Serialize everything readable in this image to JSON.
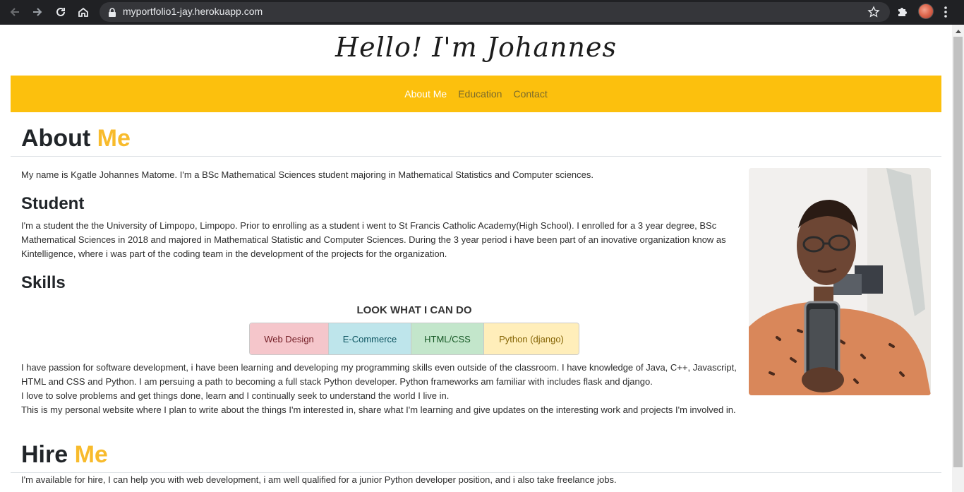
{
  "browser": {
    "url": "myportfolio1-jay.herokuapp.com"
  },
  "header": {
    "title": "Hello! I'm Johannes"
  },
  "nav": {
    "items": [
      {
        "label": "About Me"
      },
      {
        "label": "Education"
      },
      {
        "label": "Contact"
      }
    ]
  },
  "about": {
    "heading_main": "About ",
    "heading_accent": "Me",
    "intro": "My name is Kgatle Johannes Matome. I'm a BSc Mathematical Sciences student majoring in Mathematical Statistics and Computer sciences.",
    "student_heading": "Student",
    "student_lines": [
      "I'm a student the the University of Limpopo, Limpopo. Prior to enrolling as a student i went to St Francis Catholic Academy(High School). I enrolled for a 3 year degree, BSc",
      "Mathematical Sciences in 2018 and majored in Mathematical Statistic and Computer Sciences. During the 3 year period i have been part of an inovative organization know as",
      "Kintelligence, where i was part of the coding team in the development of the projects for the organization."
    ],
    "skills_heading": "Skills",
    "skills_title": "LOOK WHAT I CAN DO",
    "skills": [
      {
        "label": "Web Design",
        "bg": "#f5c6cb",
        "color": "#721c24"
      },
      {
        "label": "E-Commerce",
        "bg": "#bee5eb",
        "color": "#0c5460"
      },
      {
        "label": "HTML/CSS",
        "bg": "#c3e6cb",
        "color": "#155724"
      },
      {
        "label": "Python (django)",
        "bg": "#ffeeba",
        "color": "#856404"
      }
    ],
    "passion_lines": [
      "I have passion for software development, i have been learning and developing my programming skills even outside of the classroom. I have knowledge of Java, C++, Javascript,",
      "HTML and CSS and Python. I am persuing a path to becoming a full stack Python developer. Python frameworks am familiar with includes flask and django.",
      "I love to solve problems and get things done, learn and I continually seek to understand the world I live in.",
      "This is my personal website where I plan to write about the things I'm interested in, share what I'm learning and give updates on the interesting work and projects I'm involved in."
    ]
  },
  "hire": {
    "heading_main": "Hire ",
    "heading_accent": "Me",
    "text": "I'm available for hire, I can help you with web development, i am well qualified for a junior Python developer position, and i also take freelance jobs."
  },
  "icons": {
    "back": "back-arrow-icon",
    "forward": "forward-arrow-icon",
    "reload": "reload-icon",
    "home": "home-icon",
    "lock": "lock-icon",
    "bookmark": "star-icon",
    "extensions": "puzzle-icon",
    "menu": "kebab-menu-icon"
  },
  "colors": {
    "navbar": "#fcc00d",
    "accent": "#f8bb2c"
  }
}
